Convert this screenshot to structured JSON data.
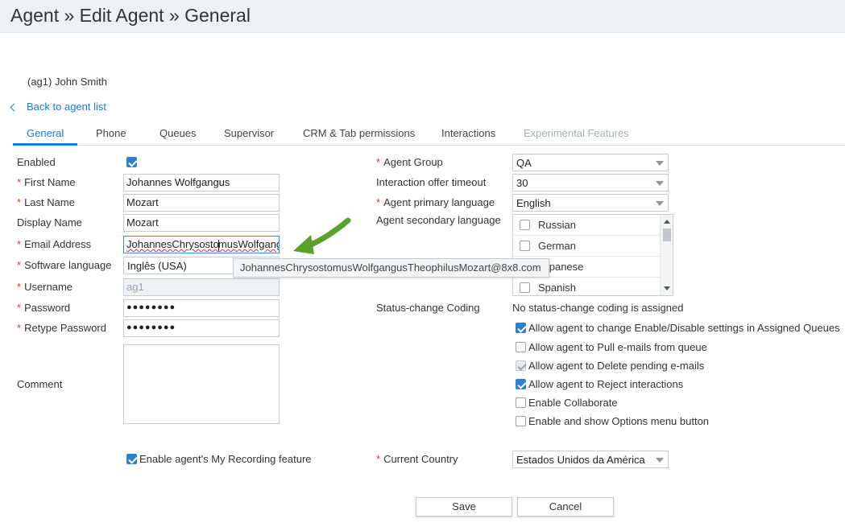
{
  "header": {
    "title": "Agent » Edit Agent » General"
  },
  "agent": {
    "display": "(ag1) John Smith"
  },
  "nav": {
    "back_label": "Back to agent list"
  },
  "tabs": [
    {
      "label": "General",
      "state": "active"
    },
    {
      "label": "Phone",
      "state": "normal"
    },
    {
      "label": "Queues",
      "state": "normal"
    },
    {
      "label": "Supervisor",
      "state": "normal"
    },
    {
      "label": "CRM & Tab permissions",
      "state": "normal"
    },
    {
      "label": "Interactions",
      "state": "normal"
    },
    {
      "label": "Experimental Features",
      "state": "disabled"
    }
  ],
  "left_form": {
    "enabled": {
      "label": "Enabled",
      "checked": true
    },
    "first_name": {
      "label": "First Name",
      "value": "Johannes  Wolfgangus"
    },
    "last_name": {
      "label": "Last Name",
      "value": "Mozart"
    },
    "display_name": {
      "label": "Display Name",
      "value": "Mozart"
    },
    "email": {
      "label": "Email Address",
      "value_part1": "JohannesChrysosto",
      "value_part2": "musWolfgangus"
    },
    "software_language": {
      "label": "Software language",
      "value": "Inglês (USA)"
    },
    "username": {
      "label": "Username",
      "value": "ag1"
    },
    "password": {
      "label": "Password",
      "value": "●●●●●●●●"
    },
    "retype_password": {
      "label": "Retype Password",
      "value": "●●●●●●●●"
    },
    "comment": {
      "label": "Comment",
      "value": ""
    },
    "my_recording": {
      "label": "Enable agent's My Recording feature",
      "checked": true
    }
  },
  "tooltip": {
    "text": "JohannesChrysostomusWolfgangusTheophilusMozart@8x8.com"
  },
  "right_form": {
    "agent_group": {
      "label": "Agent Group",
      "value": "QA"
    },
    "offer_timeout": {
      "label": "Interaction offer timeout",
      "value": "30"
    },
    "primary_language": {
      "label": "Agent primary language",
      "value": "English"
    },
    "secondary_language": {
      "label": "Agent secondary language",
      "options": [
        {
          "label": "Russian",
          "checked": false
        },
        {
          "label": "German",
          "checked": false
        },
        {
          "label": "Japanese",
          "checked": false
        },
        {
          "label": "Spanish",
          "checked": false
        }
      ]
    },
    "status_coding": {
      "label": "Status-change Coding",
      "value": "No status-change coding is assigned"
    },
    "permissions": [
      {
        "label": "Allow agent to change Enable/Disable settings in Assigned Queues",
        "checked": true,
        "disabled": false
      },
      {
        "label": "Allow agent to Pull e-mails from queue",
        "checked": false,
        "disabled": false
      },
      {
        "label": "Allow agent to Delete pending e-mails",
        "checked": true,
        "disabled": true
      },
      {
        "label": "Allow agent to Reject interactions",
        "checked": true,
        "disabled": false
      },
      {
        "label": "Enable Collaborate",
        "checked": false,
        "disabled": false
      },
      {
        "label": "Enable and show Options menu button",
        "checked": false,
        "disabled": false
      }
    ],
    "current_country": {
      "label": "Current Country",
      "value": "Estados Unidos da América"
    }
  },
  "buttons": {
    "save": "Save",
    "cancel": "Cancel"
  },
  "colors": {
    "accent": "#1a7bd1",
    "required": "#d63b3b",
    "annotation_arrow": "#5aa02c"
  }
}
